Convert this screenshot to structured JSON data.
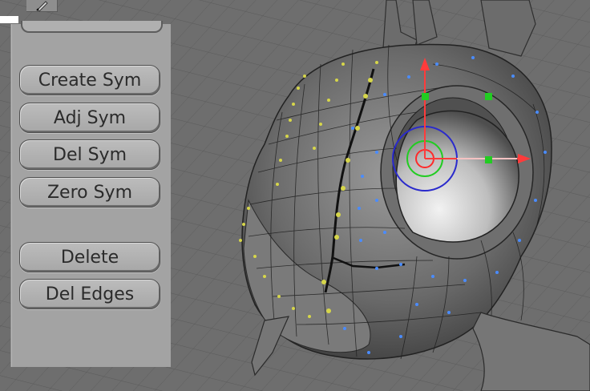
{
  "panel": {
    "buttons": [
      {
        "label": "Create Sym"
      },
      {
        "label": "Adj Sym"
      },
      {
        "label": "Del Sym"
      },
      {
        "label": "Zero Sym"
      },
      {
        "label": "Delete"
      },
      {
        "label": "Del Edges"
      }
    ]
  },
  "icons": {
    "pen": "pen-icon",
    "gizmo": "transform-gizmo"
  },
  "colors": {
    "viewport_bg": "#6e6e6e",
    "panel_bg": "#a3a3a3",
    "axis_x": "#ff3b3b",
    "axis_y": "#ff3b3b",
    "handle": "#22cc22",
    "ring_outer": "#2a2acc",
    "ring_mid": "#22cc22",
    "ring_inner": "#ff2a2a",
    "selection_dots": "#d6d64a",
    "edge_dots": "#4a8cff"
  }
}
